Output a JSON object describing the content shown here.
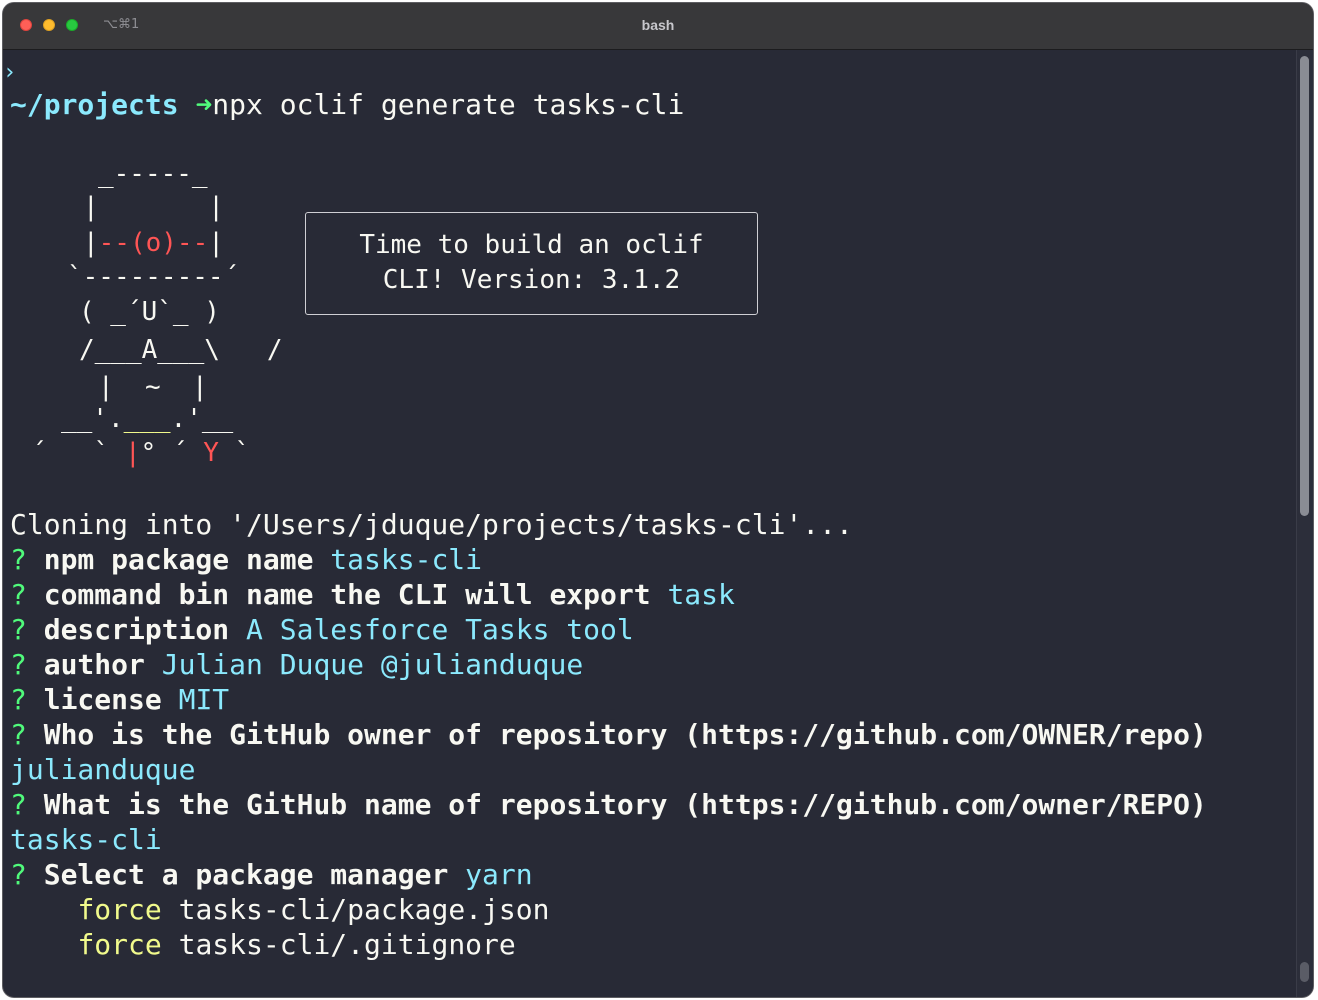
{
  "window": {
    "title": "bash",
    "shortcut": "⌥⌘1"
  },
  "terminal": {
    "cursor_mark": "›",
    "prompt": {
      "cwd": "~/projects",
      "arrow": "➜",
      "command": "npx oclif generate tasks-cli"
    },
    "art": {
      "hat_top": "_-----_",
      "hat_side": "|       |",
      "eyes_left": "|",
      "eyes": "--(o)--",
      "eyes_right": "|",
      "brim": "`---------´",
      "face_paren_l": "(",
      "face": " _´U`_ ",
      "face_paren_r": ")",
      "body": "/___A___\\   /",
      "torso_l": "|",
      "torso_mid": "~",
      "torso_r": "|",
      "belt_l": "__'.",
      "belt_mid": "___",
      "belt_r": ".'__",
      "legs_l": "´   `",
      "legs_pipe": "|",
      "legs_mid": "° ´",
      "legs_y": "Y",
      "legs_r": "`"
    },
    "speech_bubble": {
      "line1": "Time to build an oclif",
      "line2": "CLI! Version: 3.1.2"
    },
    "cloning": "Cloning into '/Users/jduque/projects/tasks-cli'...",
    "questions": [
      {
        "mark": "?",
        "question": "npm package name",
        "answer": "tasks-cli"
      },
      {
        "mark": "?",
        "question": "command bin name the CLI will export",
        "answer": "task"
      },
      {
        "mark": "?",
        "question": "description",
        "answer": "A Salesforce Tasks tool"
      },
      {
        "mark": "?",
        "question": "author",
        "answer": "Julian Duque @julianduque"
      },
      {
        "mark": "?",
        "question": "license",
        "answer": "MIT"
      },
      {
        "mark": "?",
        "question": "Who is the GitHub owner of repository (https://github.com/OWNER/repo)",
        "answer": "julianduque"
      },
      {
        "mark": "?",
        "question": "What is the GitHub name of repository (https://github.com/owner/REPO)",
        "answer": "tasks-cli"
      },
      {
        "mark": "?",
        "question": "Select a package manager",
        "answer": "yarn"
      }
    ],
    "force_lines": [
      {
        "action": "force",
        "path": "tasks-cli/package.json"
      },
      {
        "action": "force",
        "path": "tasks-cli/.gitignore"
      }
    ]
  },
  "colors": {
    "background": "#282a36",
    "foreground": "#f8f8f2",
    "cyan": "#8be9fd",
    "green": "#50fa7b",
    "yellow": "#f1fa8c",
    "red": "#ff5555"
  }
}
